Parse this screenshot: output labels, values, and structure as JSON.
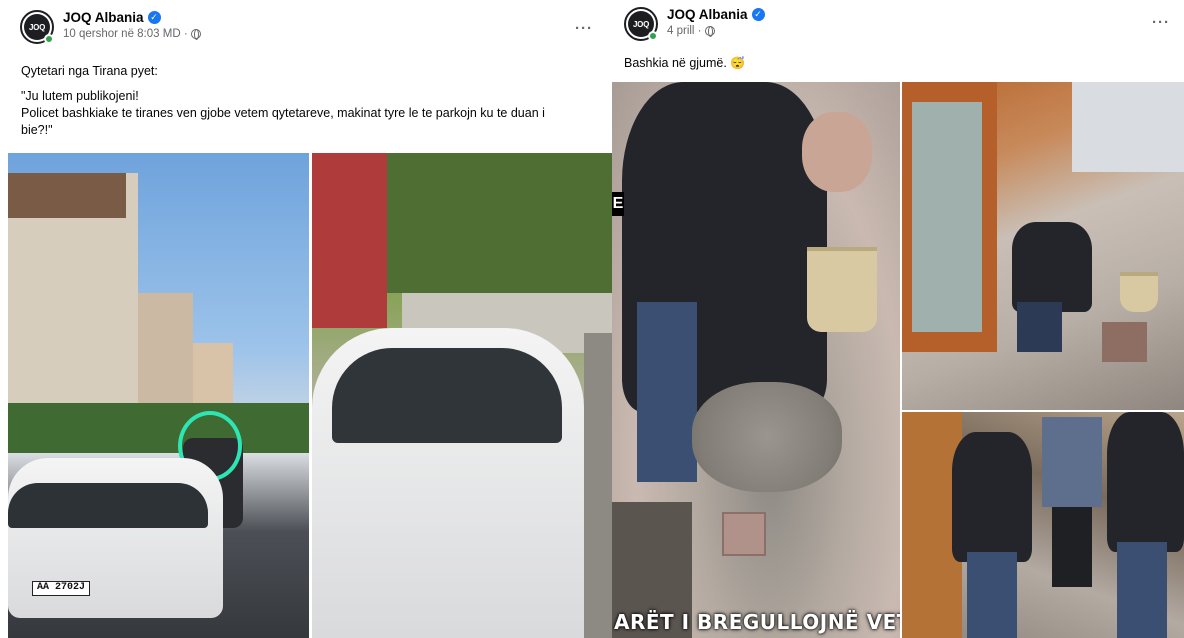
{
  "left_post": {
    "page_name": "JOQ Albania",
    "timestamp": "10 qershor në 8:03 MD ·",
    "more_label": "···",
    "avatar_text": "JOQ",
    "text_lines": [
      "Qytetari nga Tirana pyet:",
      "\"Ju lutem publikojeni!",
      "Policet bashkiake te tiranes ven gjobe vetem qytetareve, makinat tyre le te parkojn ku te duan i",
      "bie?!\""
    ],
    "photo_1": {
      "plate_text": "AA 2702J"
    }
  },
  "right_post": {
    "page_name": "JOQ Albania",
    "timestamp": "4 prill ·",
    "more_label": "···",
    "avatar_text": "JOQ",
    "text": "Bashkia në gjumë.",
    "emoji": "😴",
    "photo_1": {
      "overlay_caption": "ARËT I BREGULLOJNË VETË",
      "edge_letter": "E"
    }
  },
  "colors": {
    "verified": "#1877f2",
    "online": "#31a24c",
    "secondary_text": "#65676b",
    "highlight_ring": "#2ee6b3"
  },
  "icons": [
    "verified-badge-icon",
    "globe-icon",
    "more-options-icon"
  ]
}
